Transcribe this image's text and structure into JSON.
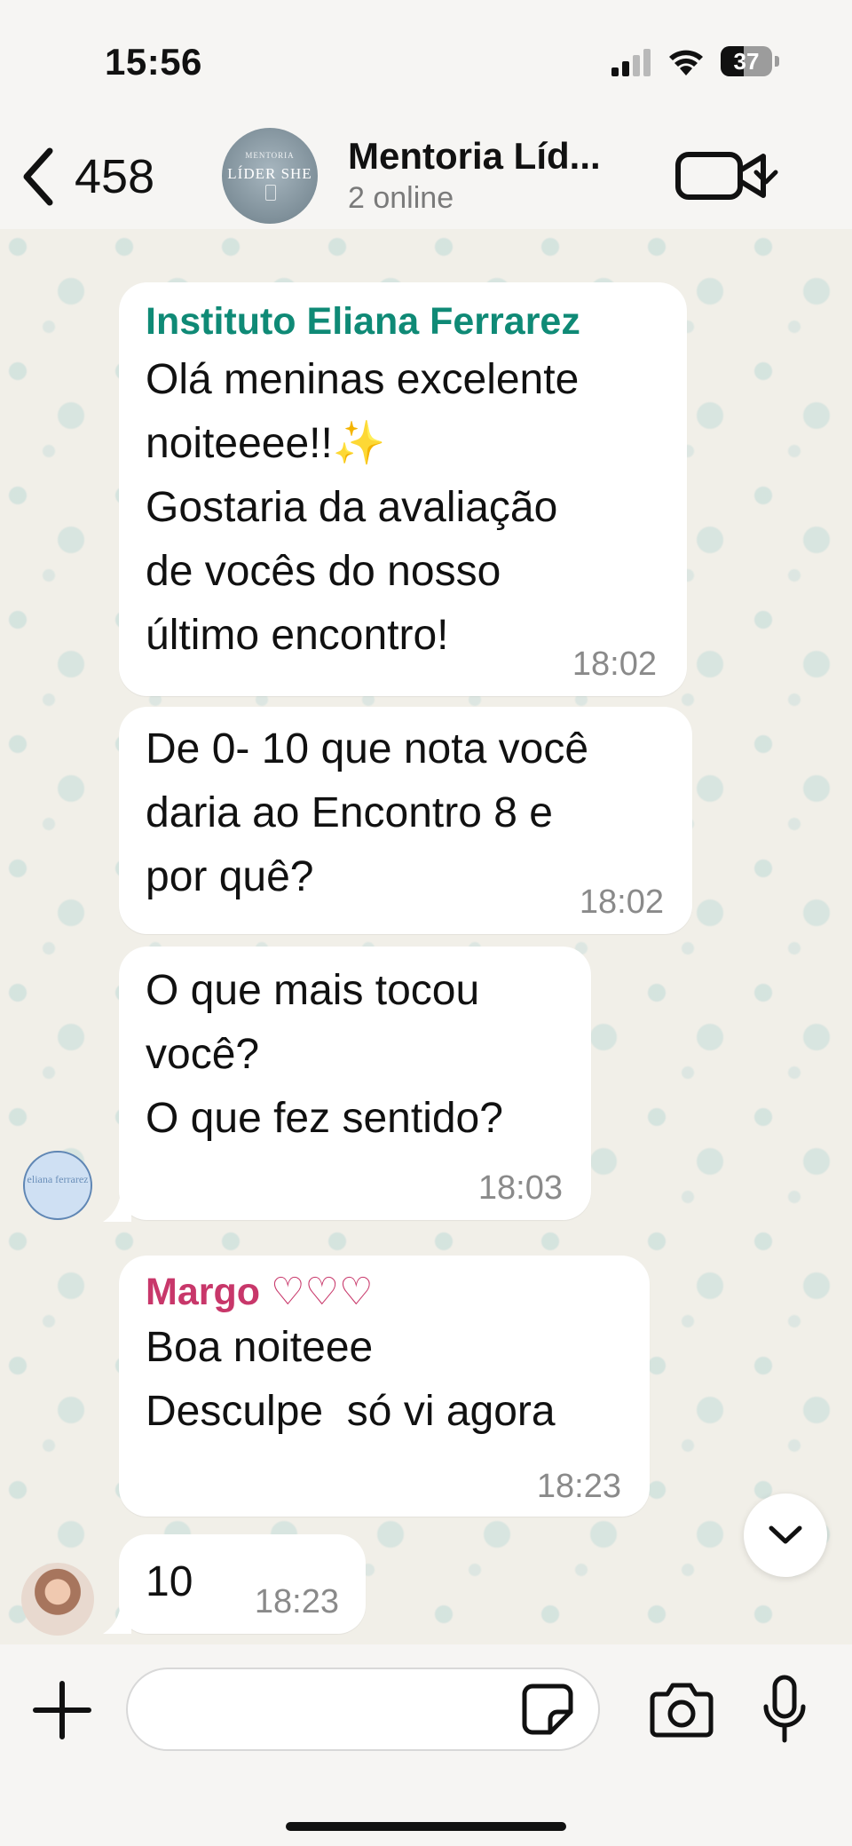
{
  "status_bar": {
    "time": "15:56",
    "battery": "37"
  },
  "header": {
    "back_count": "458",
    "group_name": "Mentoria Líd...",
    "group_status": "2 online",
    "avatar_small": "MENTORIA",
    "avatar_big": "LÍDER SHE"
  },
  "messages": [
    {
      "sender": "Instituto Eliana Ferrarez",
      "text": "Olá meninas excelente\nnoiteeee!!✨\nGostaria da avaliação\nde vocês do nosso\núltimo encontro!",
      "time": "18:02"
    },
    {
      "text": "De 0- 10 que nota você\ndaria ao Encontro 8 e\npor quê?",
      "time": "18:02"
    },
    {
      "text": "O que mais tocou\nvocê?\nO que fez sentido?",
      "time": "18:03"
    },
    {
      "sender": "Margo ♡♡♡",
      "text": "Boa noiteee\nDesculpe  só vi agora",
      "time": "18:23"
    },
    {
      "text": "10",
      "time": "18:23"
    }
  ],
  "avatars": {
    "instituto_text": "eliana ferrarez"
  },
  "input": {
    "placeholder": ""
  },
  "colors": {
    "sender_instituto": "#0f8a76",
    "sender_margo": "#c8376a"
  },
  "icons": [
    "back-chevron-icon",
    "video-camera-icon",
    "chevron-down-icon",
    "plus-icon",
    "sticker-icon",
    "camera-icon",
    "microphone-icon",
    "signal-icon",
    "wifi-icon",
    "battery-icon"
  ]
}
